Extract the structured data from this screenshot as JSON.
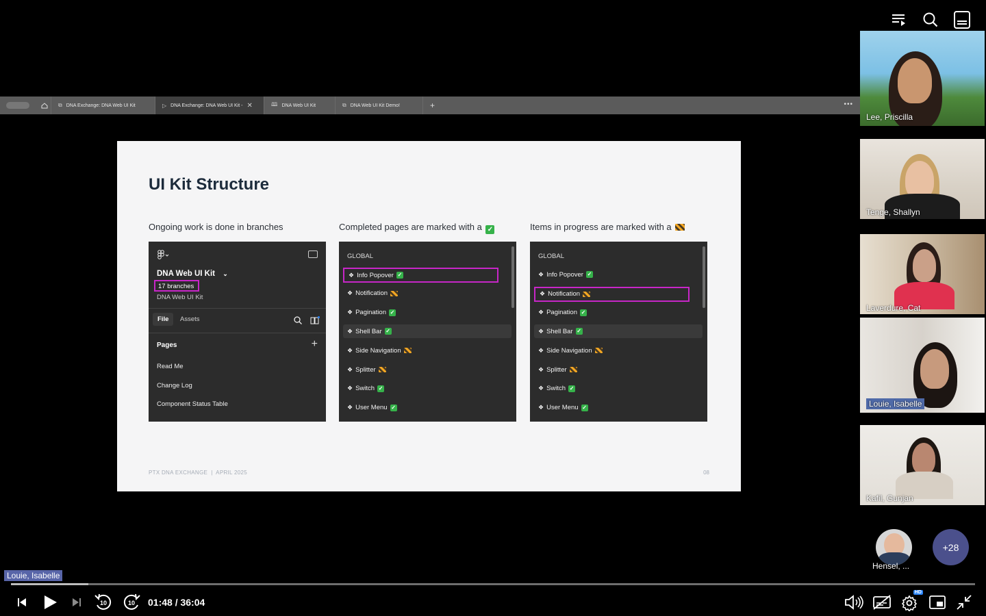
{
  "top_icons": [
    "playlist-icon",
    "search-icon",
    "transcript-icon"
  ],
  "browser": {
    "tabs": [
      {
        "label": "DNA Exchange: DNA Web UI Kit",
        "icon": "figma-slides-icon",
        "active": false
      },
      {
        "label": "DNA Exchange: DNA Web UI Kit -",
        "icon": "play-icon",
        "active": true
      },
      {
        "label": "DNA Web UI Kit",
        "icon": "book-icon",
        "active": false
      },
      {
        "label": "DNA Web UI Kit Demo!",
        "icon": "figma-slides-icon",
        "active": false
      }
    ],
    "new_tab": "+",
    "more": "•••"
  },
  "slide": {
    "title": "UI Kit Structure",
    "col1_label": "Ongoing work is done in branches",
    "col2_label": "Completed pages are marked with a",
    "col3_label": "Items in progress are marked with a",
    "panel1": {
      "file_title": "DNA Web UI Kit",
      "branches": "17 branches",
      "subtitle": "DNA Web UI Kit",
      "tab_file": "File",
      "tab_assets": "Assets",
      "pages_heading": "Pages",
      "pages": [
        "Read Me",
        "Change Log",
        "Component Status Table"
      ]
    },
    "panel2": {
      "heading": "GLOBAL",
      "items": [
        {
          "label": "Info Popover",
          "status": "done"
        },
        {
          "label": "Notification",
          "status": "progress"
        },
        {
          "label": "Pagination",
          "status": "done"
        },
        {
          "label": "Shell Bar",
          "status": "done"
        },
        {
          "label": "Side Navigation",
          "status": "progress"
        },
        {
          "label": "Splitter",
          "status": "progress"
        },
        {
          "label": "Switch",
          "status": "done"
        },
        {
          "label": "User Menu",
          "status": "done"
        }
      ]
    },
    "panel3": {
      "heading": "GLOBAL",
      "items": [
        {
          "label": "Info Popover",
          "status": "done"
        },
        {
          "label": "Notification",
          "status": "progress"
        },
        {
          "label": "Pagination",
          "status": "done"
        },
        {
          "label": "Shell Bar",
          "status": "done"
        },
        {
          "label": "Side Navigation",
          "status": "progress"
        },
        {
          "label": "Splitter",
          "status": "progress"
        },
        {
          "label": "Switch",
          "status": "done"
        },
        {
          "label": "User Menu",
          "status": "done"
        }
      ]
    },
    "footer": "PTX DNA EXCHANGE  |  APRIL 2025",
    "page_number": "08"
  },
  "participants": [
    {
      "name": "Lee, Priscilla",
      "highlighted": false
    },
    {
      "name": "Tenge, Shallyn",
      "highlighted": false
    },
    {
      "name": "Laverdure, Cat",
      "highlighted": false
    },
    {
      "name": "Louie, Isabelle",
      "highlighted": true
    },
    {
      "name": "Kafil, Gunjan",
      "highlighted": false
    }
  ],
  "small_participant": {
    "name": "Hensel, ..."
  },
  "more_participants": "+28",
  "player": {
    "speaker_label": "Louie, Isabelle",
    "time": "01:48 / 36:04",
    "progress": 0.05,
    "buffered": 0.08,
    "skip_back": "10",
    "skip_forward": "10",
    "hd_badge": "HD",
    "colors": {
      "accent": "#2b86ff",
      "highlight": "#c826c8",
      "check": "#36b24a"
    }
  }
}
